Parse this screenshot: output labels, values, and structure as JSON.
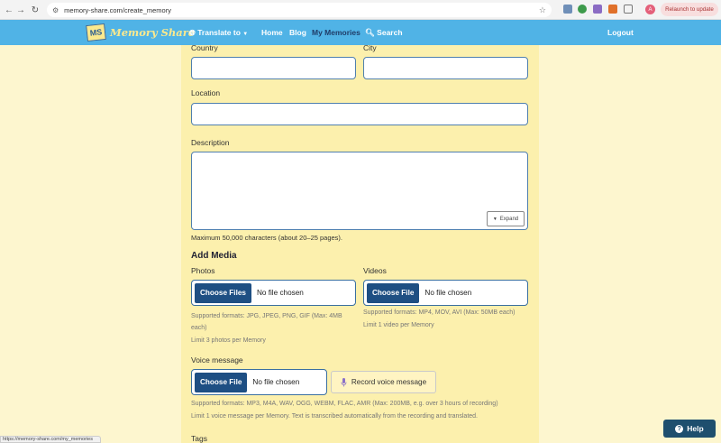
{
  "browser": {
    "url": "memory-share.com/create_memory",
    "relaunch_label": "Relaunch to update",
    "avatar_letter": "A",
    "status_url": "https://memory-share.com/my_memories"
  },
  "navbar": {
    "logo_mark": "MS",
    "logo_text": "Memory Share",
    "translate_label": "Translate to",
    "home": "Home",
    "blog": "Blog",
    "my_memories": "My Memories",
    "search": "Search",
    "logout": "Logout"
  },
  "form": {
    "country_label": "Country",
    "city_label": "City",
    "location_label": "Location",
    "description_label": "Description",
    "expand_label": "Expand",
    "description_help": "Maximum 50,000 characters (about 20–25 pages).",
    "add_media_heading": "Add Media",
    "photos_label": "Photos",
    "photos_button": "Choose Files",
    "photos_file_status": "No file chosen",
    "photos_help_1": "Supported formats: JPG, JPEG, PNG, GIF (Max: 4MB",
    "photos_help_2": "each)",
    "photos_limit": "Limit 3 photos per Memory",
    "videos_label": "Videos",
    "videos_button": "Choose File",
    "videos_file_status": "No file chosen",
    "videos_help": "Supported formats: MP4, MOV, AVI (Max: 50MB each)",
    "videos_limit": "Limit 1 video per Memory",
    "voice_label": "Voice message",
    "voice_button": "Choose File",
    "voice_file_status": "No file chosen",
    "record_label": "Record voice message",
    "voice_help": "Supported formats: MP3, M4A, WAV, OGG, WEBM, FLAC, AMR (Max: 200MB, e.g. over 3 hours of recording)",
    "voice_limit": "Limit 1 voice message per Memory. Text is transcribed automatically from the recording and translated.",
    "tags_label": "Tags"
  },
  "help_button": "Help",
  "colors": {
    "navbar": "#50b3e6",
    "page_bg": "#fdf6cf",
    "form_bg": "#fcf0ad",
    "primary_button": "#1e4f83"
  }
}
